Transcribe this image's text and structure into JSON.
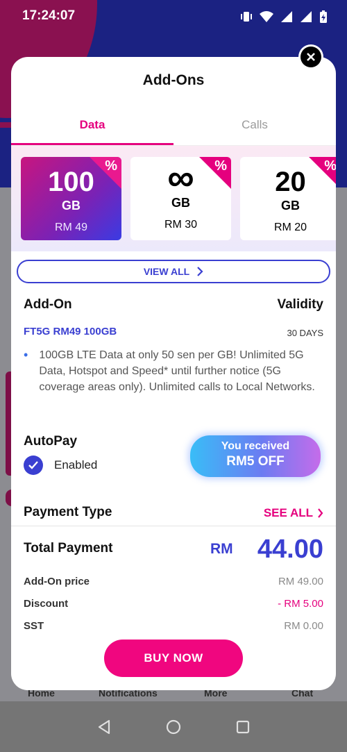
{
  "status_bar": {
    "time": "17:24:07"
  },
  "modal": {
    "title": "Add-Ons",
    "tabs": [
      {
        "label": "Data",
        "active": true
      },
      {
        "label": "Calls",
        "active": false
      }
    ],
    "plans": [
      {
        "amount": "100",
        "unit": "GB",
        "price": "RM 49",
        "badge": "%",
        "selected": true
      },
      {
        "amount": "∞",
        "unit": "GB",
        "price": "RM 30",
        "badge": "%",
        "selected": false
      },
      {
        "amount": "20",
        "unit": "GB",
        "price": "RM 20",
        "badge": "%",
        "selected": false
      }
    ],
    "view_all": "VIEW ALL",
    "details": {
      "addon_header": "Add-On",
      "validity_header": "Validity",
      "plan_name": "FT5G RM49 100GB",
      "validity": "30 DAYS",
      "description": "100GB LTE Data at only 50 sen per GB! Unlimited 5G Data, Hotspot and Speed* until further notice (5G coverage areas only). Unlimited calls to Local Networks."
    },
    "autopay": {
      "title": "AutoPay",
      "status": "Enabled",
      "enabled": true
    },
    "promo": {
      "line1": "You received",
      "line2": "RM5 OFF"
    },
    "payment_type": {
      "title": "Payment Type",
      "see_all": "SEE ALL"
    },
    "total": {
      "label": "Total Payment",
      "currency": "RM",
      "amount": "44.00",
      "lines": [
        {
          "label": "Add-On price",
          "value": "RM 49.00"
        },
        {
          "label": "Discount",
          "value": "- RM 5.00"
        },
        {
          "label": "SST",
          "value": "RM 0.00"
        }
      ]
    },
    "buy_button": "BUY NOW"
  },
  "background_nav": [
    "Home",
    "Notifications",
    "More",
    "Chat"
  ],
  "colors": {
    "accent_pink": "#e5007e",
    "accent_blue": "#3a3fd1"
  }
}
